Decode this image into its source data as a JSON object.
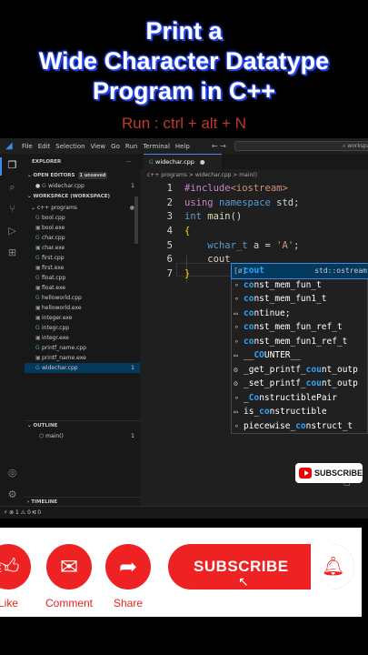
{
  "title": {
    "line1": "Print a",
    "line2": "Wide Character Datatype",
    "line3": "Program  in C++",
    "run_hint": "Run : ctrl + alt + N"
  },
  "menubar": {
    "items": [
      "File",
      "Edit",
      "Selection",
      "View",
      "Go",
      "Run",
      "Terminal",
      "Help"
    ],
    "search_text": "workspace"
  },
  "sidebar": {
    "explorer_title": "EXPLORER",
    "open_editors": "OPEN EDITORS",
    "unsaved_badge": "1 unsaved",
    "open_file": "widechar.cpp",
    "open_file_count": "1",
    "workspace": "WORKSPACE (WORKSPACE)",
    "folder": "c++ programs",
    "files": [
      {
        "name": "bool.cpp",
        "type": "cpp"
      },
      {
        "name": "bool.exe",
        "type": "exe"
      },
      {
        "name": "char.cpp",
        "type": "cpp"
      },
      {
        "name": "char.exe",
        "type": "exe"
      },
      {
        "name": "first.cpp",
        "type": "cpp"
      },
      {
        "name": "first.exe",
        "type": "exe"
      },
      {
        "name": "float.cpp",
        "type": "cpp"
      },
      {
        "name": "float.exe",
        "type": "exe"
      },
      {
        "name": "helloworld.cpp",
        "type": "cpp"
      },
      {
        "name": "helloworld.exe",
        "type": "exe"
      },
      {
        "name": "integer.exe",
        "type": "exe"
      },
      {
        "name": "integr.cpp",
        "type": "cpp"
      },
      {
        "name": "integr.exe",
        "type": "exe"
      },
      {
        "name": "printf_name.cpp",
        "type": "cpp"
      },
      {
        "name": "printf_name.exe",
        "type": "exe"
      },
      {
        "name": "widechar.cpp",
        "type": "cpp",
        "count": "1"
      }
    ],
    "outline": "OUTLINE",
    "outline_item": "main()",
    "outline_count": "1",
    "timeline": "TIMELINE"
  },
  "editor": {
    "tab_label": "widechar.cpp",
    "breadcrumb": "c++ programs > widechar.cpp > main()",
    "line_numbers": [
      "1",
      "2",
      "3",
      "4",
      "5",
      "6",
      "7"
    ]
  },
  "suggestions": [
    {
      "icon": "[ø]",
      "pre": "",
      "match": "cout",
      "post": "",
      "detail": "std::ostream"
    },
    {
      "icon": "⚬",
      "pre": "",
      "match": "co",
      "post": "nst_mem_fun_t",
      "detail": ""
    },
    {
      "icon": "⚬",
      "pre": "",
      "match": "co",
      "post": "nst_mem_fun1_t",
      "detail": ""
    },
    {
      "icon": "▭",
      "pre": "",
      "match": "co",
      "post": "ntinue;",
      "detail": ""
    },
    {
      "icon": "⚬",
      "pre": "",
      "match": "co",
      "post": "nst_mem_fun_ref_t",
      "detail": ""
    },
    {
      "icon": "⚬",
      "pre": "",
      "match": "co",
      "post": "nst_mem_fun1_ref_t",
      "detail": ""
    },
    {
      "icon": "▭",
      "pre": "__",
      "match": "CO",
      "post": "UNTER__",
      "detail": ""
    },
    {
      "icon": "⚙",
      "pre": "_get_printf_",
      "match": "cou",
      "post": "nt_outp",
      "detail": ""
    },
    {
      "icon": "⚙",
      "pre": "_set_printf_",
      "match": "cou",
      "post": "nt_outp",
      "detail": ""
    },
    {
      "icon": "⚬",
      "pre": "_",
      "match": "Co",
      "post": "nstructiblePair",
      "detail": ""
    },
    {
      "icon": "▭",
      "pre": "is_",
      "match": "co",
      "post": "nstructible",
      "detail": ""
    },
    {
      "icon": "⚬",
      "pre": "piecewise_",
      "match": "co",
      "post": "nstruct_t",
      "detail": ""
    }
  ],
  "statusbar": {
    "text": "⚡  ⊗ 1 ⚠ 0   ⑆ 0"
  },
  "mini_subscribe": "SUBSCRIBE",
  "actions": {
    "like": "Like",
    "comment": "Comment",
    "share": "Share",
    "subscribe": "SUBSCRIBE"
  }
}
